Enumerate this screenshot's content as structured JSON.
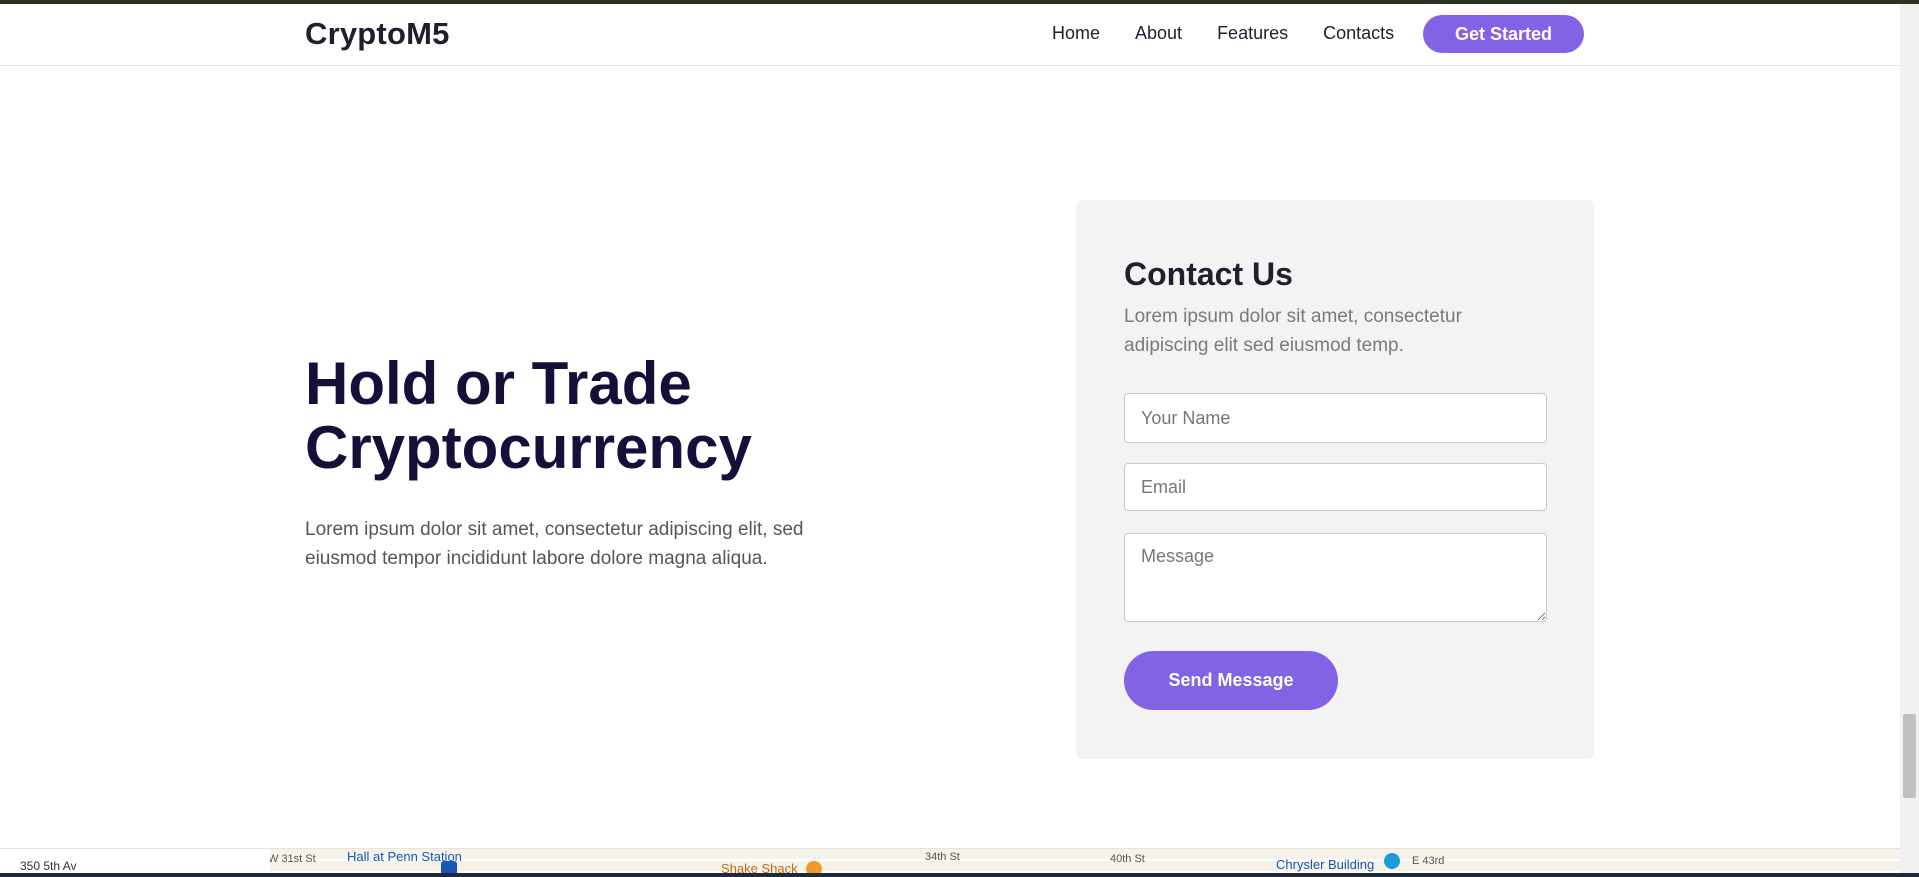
{
  "navbar": {
    "brand": "CryptoM5",
    "links": {
      "home": "Home",
      "about": "About",
      "features": "Features",
      "contacts": "Contacts"
    },
    "cta": "Get Started"
  },
  "hero": {
    "title_line1": "Hold or Trade",
    "title_line2": "Cryptocurrency",
    "text": "Lorem ipsum dolor sit amet, consectetur adipiscing elit, sed eiusmod tempor incididunt labore dolore magna aliqua."
  },
  "contact": {
    "title": "Contact Us",
    "subtitle": "Lorem ipsum dolor sit amet, consectetur adipiscing elit sed eiusmod temp.",
    "name_placeholder": "Your Name",
    "email_placeholder": "Email",
    "message_placeholder": "Message",
    "send_label": "Send Message"
  },
  "map": {
    "labels": {
      "penn": "Hall at Penn Station",
      "shake": "Shake Shack",
      "chrysler": "Chrysler Building",
      "st31": "W 31st St",
      "st34": "34th St",
      "st40": "40th St",
      "e43": "E 43rd",
      "attrib": "350 5th Av"
    }
  },
  "colors": {
    "accent": "#8263e3",
    "heading": "#170e3a",
    "card_bg": "#f3f3f3"
  }
}
